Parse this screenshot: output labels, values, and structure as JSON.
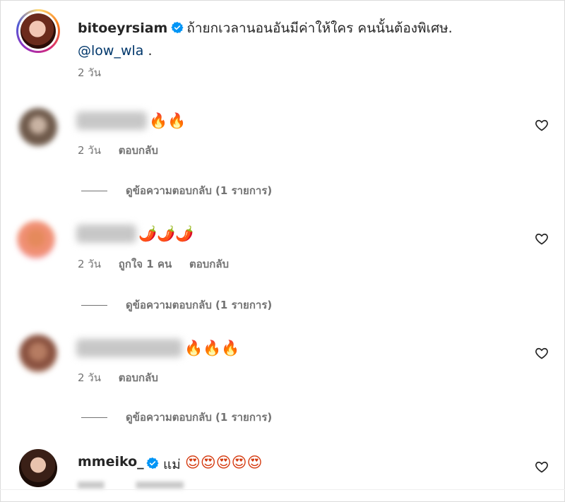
{
  "post": {
    "username": "bitoeyrsiam",
    "verified": true,
    "caption": "ถ้ายกเวลานอนอันมีค่าให้ใคร คนนั้นต้องพิเศษ.",
    "mention": "@low_wla",
    "mention_suffix": " .",
    "time": "2 วัน"
  },
  "comments": [
    {
      "username_blurred": true,
      "emojis": "🔥🔥",
      "time": "2 วัน",
      "likes": "",
      "reply_label": "ตอบกลับ",
      "view_replies_label": "ดูข้อความตอบกลับ (1 รายการ)"
    },
    {
      "username_blurred": true,
      "emojis": "🌶️🌶️🌶️",
      "time": "2 วัน",
      "likes": "ถูกใจ 1 คน",
      "reply_label": "ตอบกลับ",
      "view_replies_label": "ดูข้อความตอบกลับ (1 รายการ)"
    },
    {
      "username_blurred": true,
      "emojis": "🔥🔥🔥",
      "time": "2 วัน",
      "likes": "",
      "reply_label": "ตอบกลับ",
      "view_replies_label": "ดูข้อความตอบกลับ (1 รายการ)"
    },
    {
      "username": "mmeiko_",
      "verified": true,
      "text": "แม่",
      "emojis": "😍😍😍😍😍"
    }
  ],
  "icons": {
    "verified_badge": "verified-badge-icon",
    "like": "heart-outline-icon"
  },
  "colors": {
    "verified_blue": "#0095f6",
    "mention_blue": "#00376b",
    "secondary_text": "#737373"
  }
}
